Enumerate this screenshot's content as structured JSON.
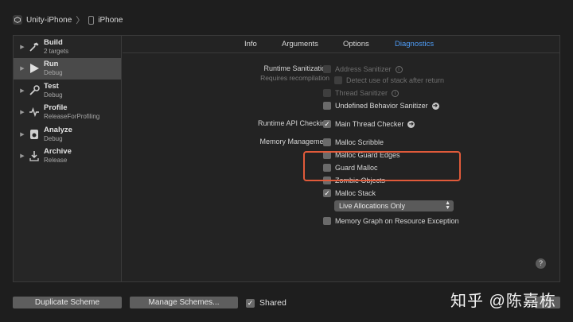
{
  "breadcrumb": {
    "scheme": "Unity-iPhone",
    "device": "iPhone"
  },
  "sidebar": {
    "items": [
      {
        "name": "Build",
        "sub": "2 targets",
        "icon": "hammer-icon",
        "selected": false
      },
      {
        "name": "Run",
        "sub": "Debug",
        "icon": "play-icon",
        "selected": true
      },
      {
        "name": "Test",
        "sub": "Debug",
        "icon": "wrench-icon",
        "selected": false
      },
      {
        "name": "Profile",
        "sub": "ReleaseForProfiling",
        "icon": "instruments-icon",
        "selected": false
      },
      {
        "name": "Analyze",
        "sub": "Debug",
        "icon": "analyze-icon",
        "selected": false
      },
      {
        "name": "Archive",
        "sub": "Release",
        "icon": "archive-icon",
        "selected": false
      }
    ]
  },
  "tabs": [
    "Info",
    "Arguments",
    "Options",
    "Diagnostics"
  ],
  "active_tab": "Diagnostics",
  "sections": {
    "runtime_sanitization": "Runtime Sanitization",
    "requires_recompilation": "Requires recompilation",
    "runtime_api_checking": "Runtime API Checking",
    "memory_management": "Memory Management"
  },
  "options": {
    "address_sanitizer": "Address Sanitizer",
    "detect_stack_use": "Detect use of stack after return",
    "thread_sanitizer": "Thread Sanitizer",
    "undefined_behavior": "Undefined Behavior Sanitizer",
    "main_thread_checker": "Main Thread Checker",
    "malloc_scribble": "Malloc Scribble",
    "malloc_guard_edges": "Malloc Guard Edges",
    "guard_malloc": "Guard Malloc",
    "zombie_objects": "Zombie Objects",
    "malloc_stack": "Malloc Stack",
    "memory_graph": "Memory Graph on Resource Exception"
  },
  "malloc_stack_popup": "Live Allocations Only",
  "footer": {
    "duplicate_scheme": "Duplicate Scheme",
    "manage_schemes": "Manage Schemes...",
    "shared": "Shared"
  },
  "watermark": "知乎 @陈嘉栋",
  "colors": {
    "accent": "#4e9cf6",
    "highlight": "#e05a3a",
    "background": "#1e1e1e"
  }
}
